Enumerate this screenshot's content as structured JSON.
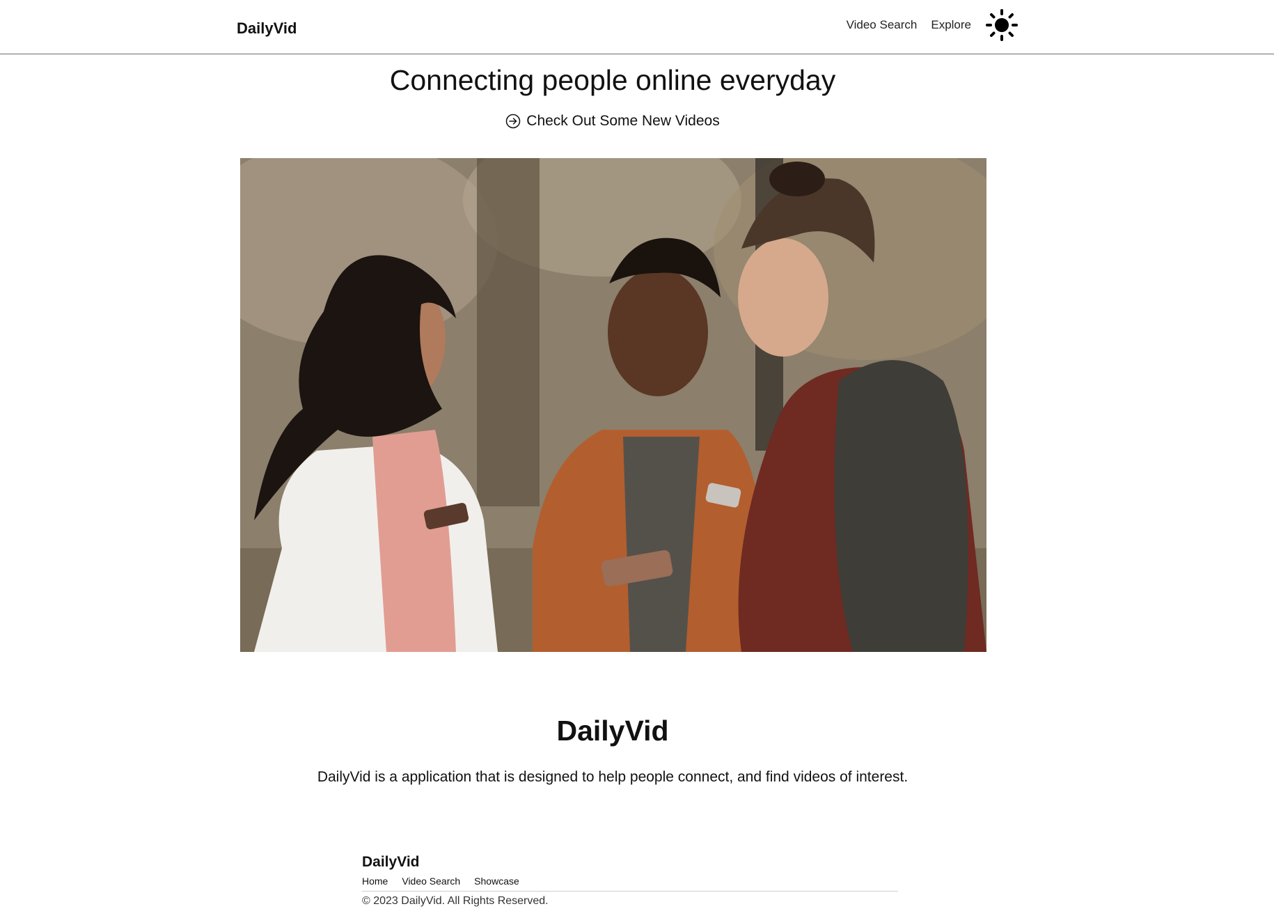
{
  "header": {
    "brand": "DailyVid",
    "nav": [
      {
        "label": "Video Search"
      },
      {
        "label": "Explore"
      }
    ],
    "theme_toggle_icon": "sun-icon"
  },
  "hero": {
    "title": "Connecting people online everyday",
    "cta_label": "Check Out Some New Videos",
    "cta_icon": "arrow-right-circle-icon"
  },
  "about": {
    "title": "DailyVid",
    "text": "DailyVid is a application that is designed to help people connect, and find videos of interest."
  },
  "footer": {
    "brand": "DailyVid",
    "links": [
      {
        "label": "Home"
      },
      {
        "label": "Video Search"
      },
      {
        "label": "Showcase"
      }
    ],
    "copyright": "© 2023 DailyVid. All Rights Reserved."
  }
}
